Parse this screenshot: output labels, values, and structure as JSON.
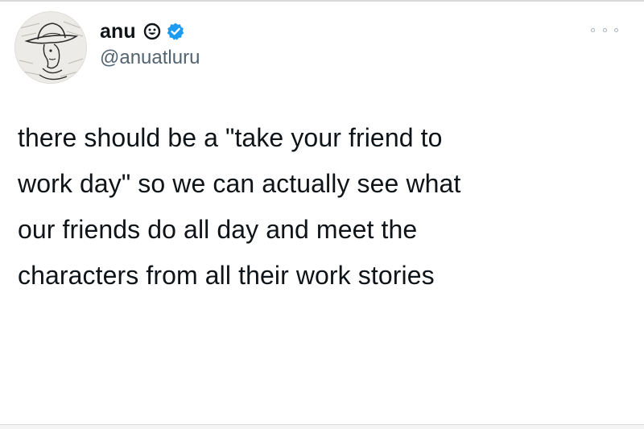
{
  "tweet": {
    "author": {
      "display_name": "anu",
      "handle": "@anuatluru",
      "avatar_icon": "cowboy-sketch-avatar",
      "badges": [
        "smiley-face-icon",
        "verified-badge-icon"
      ]
    },
    "menu_icon": "more-options-icon",
    "text_lines": [
      "there should be a \"take your friend to",
      "work day\" so we can actually see what",
      "our friends do all day and meet the",
      "characters from all their work stories"
    ]
  },
  "colors": {
    "text": "#0f1419",
    "handle": "#536471",
    "verified": "#1d9bf0",
    "background": "#ffffff"
  }
}
